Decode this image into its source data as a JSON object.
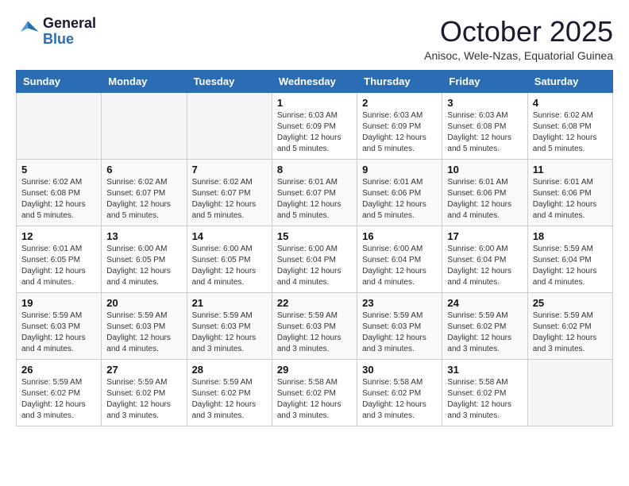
{
  "logo": {
    "line1": "General",
    "line2": "Blue"
  },
  "header": {
    "month": "October 2025",
    "location": "Anisoc, Wele-Nzas, Equatorial Guinea"
  },
  "weekdays": [
    "Sunday",
    "Monday",
    "Tuesday",
    "Wednesday",
    "Thursday",
    "Friday",
    "Saturday"
  ],
  "weeks": [
    [
      {
        "day": "",
        "info": ""
      },
      {
        "day": "",
        "info": ""
      },
      {
        "day": "",
        "info": ""
      },
      {
        "day": "1",
        "info": "Sunrise: 6:03 AM\nSunset: 6:09 PM\nDaylight: 12 hours\nand 5 minutes."
      },
      {
        "day": "2",
        "info": "Sunrise: 6:03 AM\nSunset: 6:09 PM\nDaylight: 12 hours\nand 5 minutes."
      },
      {
        "day": "3",
        "info": "Sunrise: 6:03 AM\nSunset: 6:08 PM\nDaylight: 12 hours\nand 5 minutes."
      },
      {
        "day": "4",
        "info": "Sunrise: 6:02 AM\nSunset: 6:08 PM\nDaylight: 12 hours\nand 5 minutes."
      }
    ],
    [
      {
        "day": "5",
        "info": "Sunrise: 6:02 AM\nSunset: 6:08 PM\nDaylight: 12 hours\nand 5 minutes."
      },
      {
        "day": "6",
        "info": "Sunrise: 6:02 AM\nSunset: 6:07 PM\nDaylight: 12 hours\nand 5 minutes."
      },
      {
        "day": "7",
        "info": "Sunrise: 6:02 AM\nSunset: 6:07 PM\nDaylight: 12 hours\nand 5 minutes."
      },
      {
        "day": "8",
        "info": "Sunrise: 6:01 AM\nSunset: 6:07 PM\nDaylight: 12 hours\nand 5 minutes."
      },
      {
        "day": "9",
        "info": "Sunrise: 6:01 AM\nSunset: 6:06 PM\nDaylight: 12 hours\nand 5 minutes."
      },
      {
        "day": "10",
        "info": "Sunrise: 6:01 AM\nSunset: 6:06 PM\nDaylight: 12 hours\nand 4 minutes."
      },
      {
        "day": "11",
        "info": "Sunrise: 6:01 AM\nSunset: 6:06 PM\nDaylight: 12 hours\nand 4 minutes."
      }
    ],
    [
      {
        "day": "12",
        "info": "Sunrise: 6:01 AM\nSunset: 6:05 PM\nDaylight: 12 hours\nand 4 minutes."
      },
      {
        "day": "13",
        "info": "Sunrise: 6:00 AM\nSunset: 6:05 PM\nDaylight: 12 hours\nand 4 minutes."
      },
      {
        "day": "14",
        "info": "Sunrise: 6:00 AM\nSunset: 6:05 PM\nDaylight: 12 hours\nand 4 minutes."
      },
      {
        "day": "15",
        "info": "Sunrise: 6:00 AM\nSunset: 6:04 PM\nDaylight: 12 hours\nand 4 minutes."
      },
      {
        "day": "16",
        "info": "Sunrise: 6:00 AM\nSunset: 6:04 PM\nDaylight: 12 hours\nand 4 minutes."
      },
      {
        "day": "17",
        "info": "Sunrise: 6:00 AM\nSunset: 6:04 PM\nDaylight: 12 hours\nand 4 minutes."
      },
      {
        "day": "18",
        "info": "Sunrise: 5:59 AM\nSunset: 6:04 PM\nDaylight: 12 hours\nand 4 minutes."
      }
    ],
    [
      {
        "day": "19",
        "info": "Sunrise: 5:59 AM\nSunset: 6:03 PM\nDaylight: 12 hours\nand 4 minutes."
      },
      {
        "day": "20",
        "info": "Sunrise: 5:59 AM\nSunset: 6:03 PM\nDaylight: 12 hours\nand 4 minutes."
      },
      {
        "day": "21",
        "info": "Sunrise: 5:59 AM\nSunset: 6:03 PM\nDaylight: 12 hours\nand 3 minutes."
      },
      {
        "day": "22",
        "info": "Sunrise: 5:59 AM\nSunset: 6:03 PM\nDaylight: 12 hours\nand 3 minutes."
      },
      {
        "day": "23",
        "info": "Sunrise: 5:59 AM\nSunset: 6:03 PM\nDaylight: 12 hours\nand 3 minutes."
      },
      {
        "day": "24",
        "info": "Sunrise: 5:59 AM\nSunset: 6:02 PM\nDaylight: 12 hours\nand 3 minutes."
      },
      {
        "day": "25",
        "info": "Sunrise: 5:59 AM\nSunset: 6:02 PM\nDaylight: 12 hours\nand 3 minutes."
      }
    ],
    [
      {
        "day": "26",
        "info": "Sunrise: 5:59 AM\nSunset: 6:02 PM\nDaylight: 12 hours\nand 3 minutes."
      },
      {
        "day": "27",
        "info": "Sunrise: 5:59 AM\nSunset: 6:02 PM\nDaylight: 12 hours\nand 3 minutes."
      },
      {
        "day": "28",
        "info": "Sunrise: 5:59 AM\nSunset: 6:02 PM\nDaylight: 12 hours\nand 3 minutes."
      },
      {
        "day": "29",
        "info": "Sunrise: 5:58 AM\nSunset: 6:02 PM\nDaylight: 12 hours\nand 3 minutes."
      },
      {
        "day": "30",
        "info": "Sunrise: 5:58 AM\nSunset: 6:02 PM\nDaylight: 12 hours\nand 3 minutes."
      },
      {
        "day": "31",
        "info": "Sunrise: 5:58 AM\nSunset: 6:02 PM\nDaylight: 12 hours\nand 3 minutes."
      },
      {
        "day": "",
        "info": ""
      }
    ]
  ]
}
